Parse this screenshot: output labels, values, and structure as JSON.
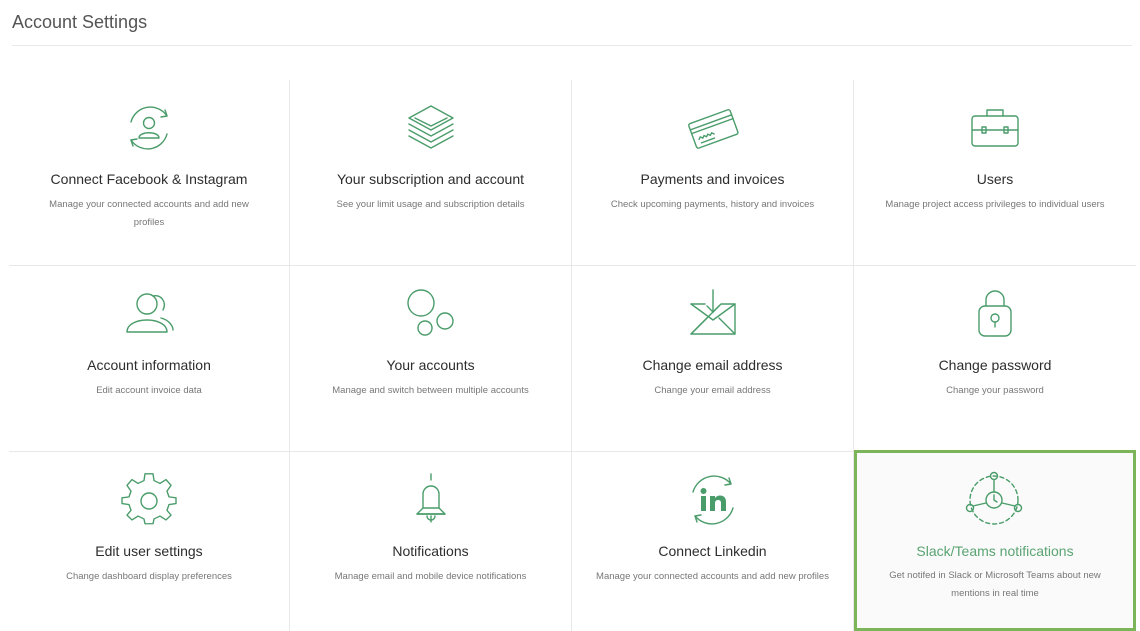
{
  "page": {
    "title": "Account Settings"
  },
  "tiles": [
    {
      "title": "Connect Facebook & Instagram",
      "desc": "Manage your connected accounts and add new profiles",
      "icon": "account-sync-icon"
    },
    {
      "title": "Your subscription and account",
      "desc": "See your limit usage and subscription details",
      "icon": "layers-icon"
    },
    {
      "title": "Payments and invoices",
      "desc": "Check upcoming payments, history and invoices",
      "icon": "credit-card-icon"
    },
    {
      "title": "Users",
      "desc": "Manage project access privileges to individual users",
      "icon": "briefcase-icon"
    },
    {
      "title": "Account information",
      "desc": "Edit account invoice data",
      "icon": "user-icon"
    },
    {
      "title": "Your accounts",
      "desc": "Manage and switch between multiple accounts",
      "icon": "circles-icon"
    },
    {
      "title": "Change email address",
      "desc": "Change your email address",
      "icon": "envelope-icon"
    },
    {
      "title": "Change password",
      "desc": "Change your password",
      "icon": "lock-icon"
    },
    {
      "title": "Edit user settings",
      "desc": "Change dashboard display preferences",
      "icon": "gear-icon"
    },
    {
      "title": "Notifications",
      "desc": "Manage email and mobile device notifications",
      "icon": "bell-icon"
    },
    {
      "title": "Connect Linkedin",
      "desc": "Manage your connected accounts and add new profiles",
      "icon": "linkedin-icon"
    },
    {
      "title": "Slack/Teams notifications",
      "desc": "Get notifed in Slack or Microsoft Teams about new mentions in real time",
      "icon": "network-clock-icon"
    }
  ],
  "colors": {
    "accent": "#4a9c6a",
    "active_border": "#7cb45a",
    "active_title": "#5aa472"
  }
}
